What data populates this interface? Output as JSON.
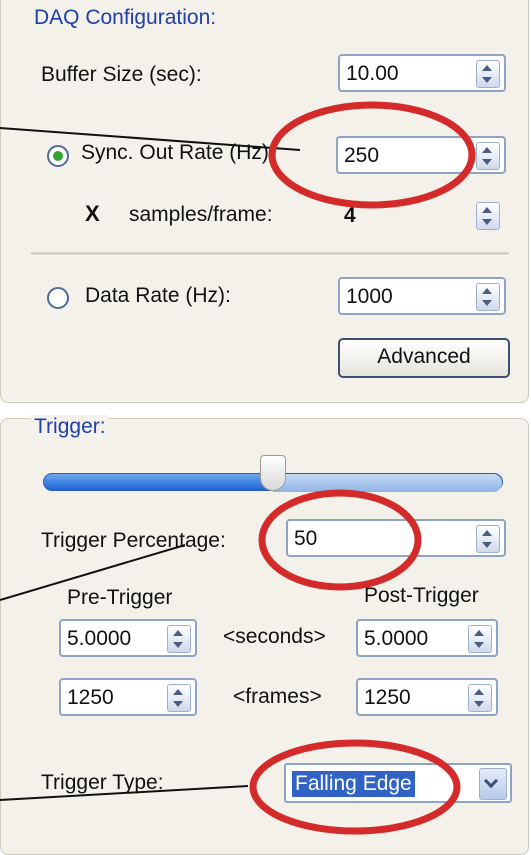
{
  "daq": {
    "title": "DAQ Configuration:",
    "buffer_size_label": "Buffer Size (sec):",
    "buffer_size_value": "10.00",
    "sync_out_rate_label": "Sync. Out Rate (Hz):",
    "sync_out_rate_value": "250",
    "sync_out_rate_selected": true,
    "multiply_symbol": "X",
    "samples_per_frame_label": "samples/frame:",
    "samples_per_frame_value": "4",
    "data_rate_label": "Data Rate (Hz):",
    "data_rate_value": "1000",
    "data_rate_selected": false,
    "advanced_button": "Advanced"
  },
  "trigger": {
    "title": "Trigger:",
    "slider_fraction": 0.5,
    "percentage_label": "Trigger Percentage:",
    "percentage_value": "50",
    "pre_trigger_header": "Pre-Trigger",
    "post_trigger_header": "Post-Trigger",
    "seconds_label": "<seconds>",
    "frames_label": "<frames>",
    "pre_seconds": "5.0000",
    "post_seconds": "5.0000",
    "pre_frames": "1250",
    "post_frames": "1250",
    "type_label": "Trigger Type:",
    "type_value": "Falling Edge"
  },
  "colors": {
    "annotation_circle": "#d42a2a",
    "panel_title": "#1f3fa8",
    "selection": "#3163c6"
  }
}
